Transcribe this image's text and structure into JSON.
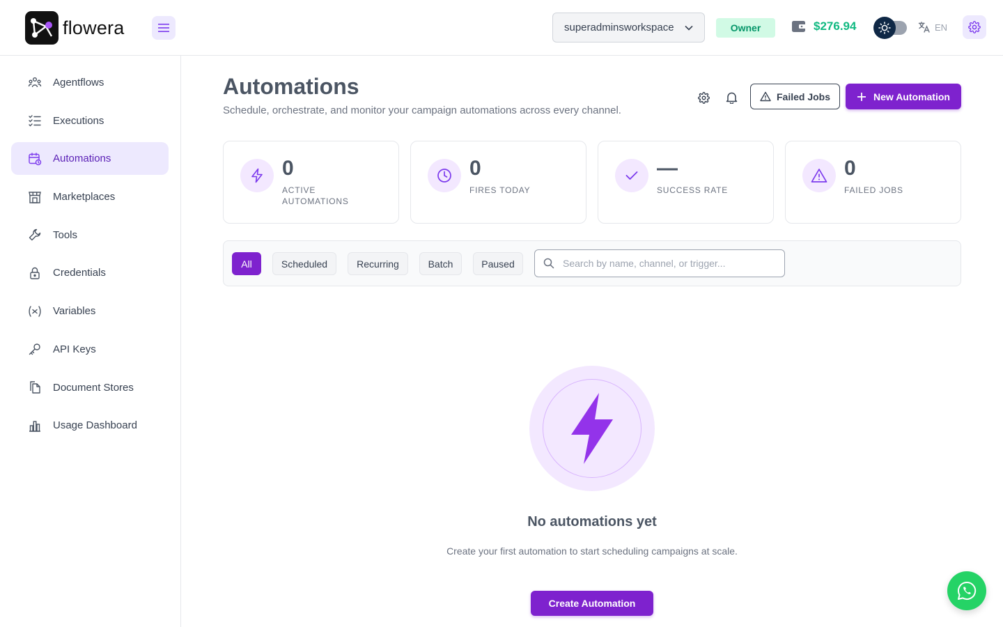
{
  "brand": {
    "name": "flowera"
  },
  "header": {
    "workspace": "superadminsworkspace",
    "role_badge": "Owner",
    "wallet_balance": "$276.94",
    "language": "EN",
    "accent_color": "#7e22ce",
    "balance_color": "#10b981"
  },
  "sidebar": {
    "items": [
      {
        "label": "Agentflows",
        "icon": "agentflows-icon",
        "active": false
      },
      {
        "label": "Executions",
        "icon": "list-check-icon",
        "active": false
      },
      {
        "label": "Automations",
        "icon": "calendar-clock-icon",
        "active": true
      },
      {
        "label": "Marketplaces",
        "icon": "store-icon",
        "active": false
      },
      {
        "label": "Tools",
        "icon": "wrench-icon",
        "active": false
      },
      {
        "label": "Credentials",
        "icon": "lock-icon",
        "active": false
      },
      {
        "label": "Variables",
        "icon": "variable-icon",
        "active": false
      },
      {
        "label": "API Keys",
        "icon": "key-icon",
        "active": false
      },
      {
        "label": "Document Stores",
        "icon": "files-icon",
        "active": false
      },
      {
        "label": "Usage Dashboard",
        "icon": "bar-chart-icon",
        "active": false
      }
    ]
  },
  "page": {
    "title": "Automations",
    "subtitle": "Schedule, orchestrate, and monitor your campaign automations across every channel.",
    "failed_jobs_label": "Failed Jobs",
    "new_automation_label": "New Automation"
  },
  "stats": [
    {
      "value": "0",
      "label": "ACTIVE AUTOMATIONS",
      "icon": "bolt-icon"
    },
    {
      "value": "0",
      "label": "FIRES TODAY",
      "icon": "clock-icon"
    },
    {
      "value": "—",
      "label": "SUCCESS RATE",
      "icon": "check-icon"
    },
    {
      "value": "0",
      "label": "FAILED JOBS",
      "icon": "warning-icon"
    }
  ],
  "filters": {
    "chips": [
      "All",
      "Scheduled",
      "Recurring",
      "Batch",
      "Paused"
    ],
    "active": "All",
    "search_placeholder": "Search by name, channel, or trigger..."
  },
  "empty_state": {
    "title": "No automations yet",
    "description": "Create your first automation to start scheduling campaigns at scale.",
    "button_label": "Create Automation"
  }
}
